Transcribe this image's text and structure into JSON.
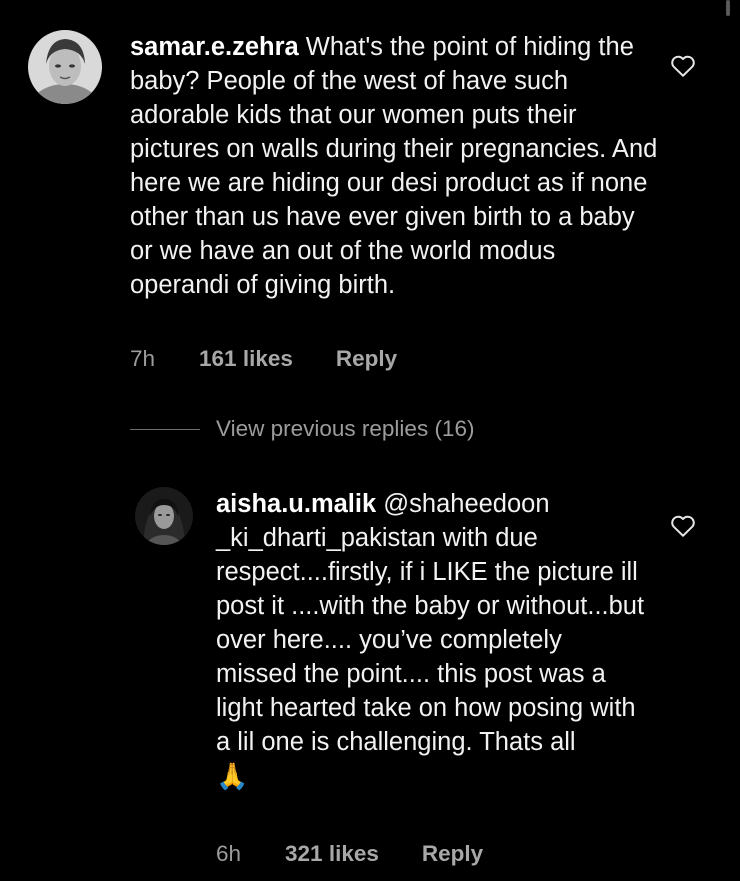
{
  "comments": [
    {
      "username": "samar.e.zehra",
      "text": "What's the point of hiding the baby? People of the west of have such adorable kids that our women puts their pictures on walls during their pregnancies. And here we are hiding our desi product as if none other than us have ever given birth to a baby or we have an out of the world modus operandi of giving birth.",
      "time": "7h",
      "likes": "161 likes",
      "reply_label": "Reply",
      "like_icon": "heart-outline-icon"
    }
  ],
  "view_replies_label": "View previous replies (16)",
  "replies": [
    {
      "username": "aisha.u.malik",
      "text": "@shaheedoon _ki_dharti_pakistan with due respect....firstly, if i LIKE the picture ill post it ....with the baby or without...but over here.... you’ve completely missed the point.... this post was a light hearted take on how posing with a lil one is challenging. Thats all",
      "emoji": "🙏",
      "time": "6h",
      "likes": "321 likes",
      "reply_label": "Reply",
      "like_icon": "heart-outline-icon"
    }
  ],
  "colors": {
    "background": "#000000",
    "text": "#f2f2f2",
    "muted": "#9c9c9c"
  }
}
